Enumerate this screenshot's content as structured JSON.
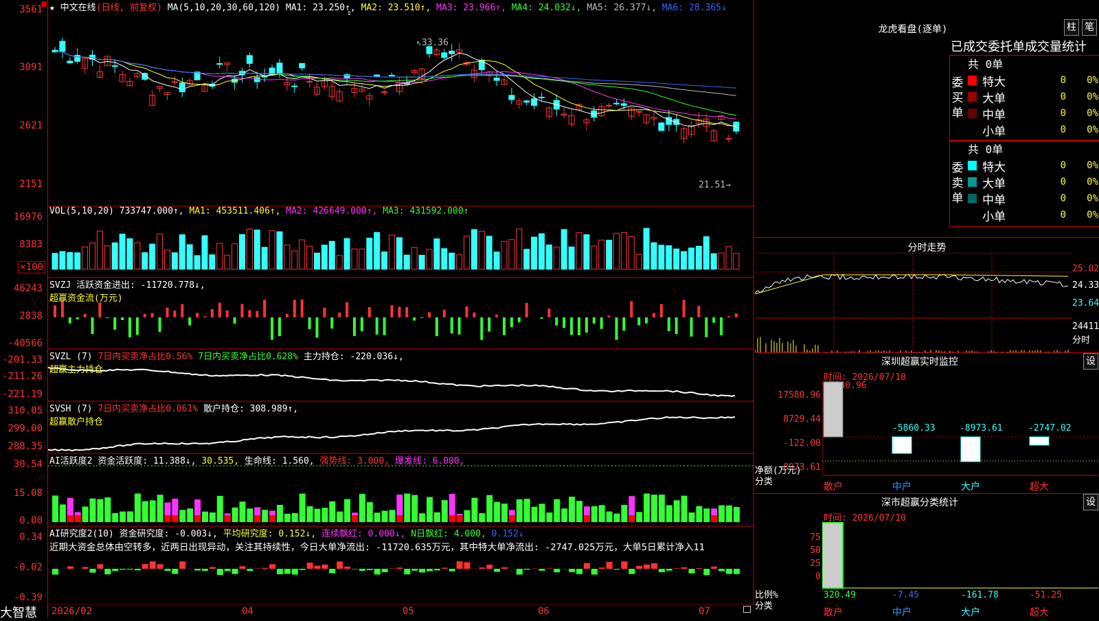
{
  "app": {
    "brand": "大智慧",
    "date_start": "2026/02",
    "month_labels": [
      "04",
      "05",
      "06",
      "07"
    ]
  },
  "kline": {
    "axis": [
      "3561",
      "3091",
      "2621",
      "2151"
    ],
    "title": "中文在线",
    "period": "(日线, 前复权)",
    "ma_label": "MA(5,10,20,30,60,120)",
    "ma1": "MA1: 23.250↑,",
    "ma2": "MA2: 23.510↑,",
    "ma3": "MA3: 23.966↑,",
    "ma4": "MA4: 24.032↓,",
    "ma5": "MA5: 26.377↓,",
    "ma6": "MA6: 28.365↓",
    "high_label": "33.36",
    "low_label": "21.51"
  },
  "vol": {
    "axis": [
      "16976",
      "8383"
    ],
    "unit": "×100",
    "label": "VOL(5,10,20)",
    "value": "733747.000↑,",
    "ma1": "MA1: 453511.406↑,",
    "ma2": "MA2: 426649.000↑,",
    "ma3": "MA3: 431592.000↑"
  },
  "svzj": {
    "axis": [
      "46243",
      "2838",
      "-40566"
    ],
    "label": "SVZJ  活跃资金进出: -11720.778↓,",
    "subtitle": "超赢资金流(万元)"
  },
  "svzl": {
    "axis": [
      "-201.33",
      "-211.26",
      "-221.19"
    ],
    "label": "SVZL (7)",
    "pct1": "7日内买卖净占比0.56%",
    "pct2": "7日内买卖净占比0.628%",
    "hold": "主力持仓: -220.036↓,",
    "subtitle": "超赢主力持仓"
  },
  "svsh": {
    "axis": [
      "310.05",
      "299.00",
      "288.35"
    ],
    "label": "SVSH (7)",
    "pct": "7日内买卖净占比0.061%",
    "hold": "散户持仓: 308.989↑,",
    "subtitle": "超赢散户持仓"
  },
  "ai_active": {
    "axis": [
      "30.54",
      "15.08",
      "0.00"
    ],
    "label": "AI活跃度2",
    "v1": "资金活跃度: 11.388↓,",
    "v2": "30.535,",
    "v3": "生命线: 1.560,",
    "v4": "强势线: 3.000,",
    "v5": "爆发线: 6.000,"
  },
  "ai_research": {
    "axis": [
      "0.34",
      "-0.02",
      "-0.39"
    ],
    "label": "AI研究度2(10)",
    "v1": "资金研究度: -0.003↓,",
    "v2": "平均研究度: 0.152↓,",
    "v3": "连续飘红: 0.000↓,",
    "v4": "N日飘红: 4.000,",
    "v5": "0.152↓",
    "comment": "近期大资金总体由空转多，近两日出现异动，关注其持续性，今日大单净流出: -11720.635万元，其中特大单净流出: -2747.025万元，大单5日累计净入11"
  },
  "lhb": {
    "title": "龙虎看盘(逐单)",
    "btn1": "柱",
    "btn2": "笔",
    "subtitle": "已成交委托单成交量统计",
    "buy_label": "委买单",
    "sell_label": "委卖单",
    "buy_total": "共 0单",
    "sell_total": "共 0单",
    "buy_rows": [
      {
        "name": "特大",
        "n": "0",
        "p": "0%",
        "color": "#ff0000"
      },
      {
        "name": "大单",
        "n": "0",
        "p": "0%",
        "color": "#990000"
      },
      {
        "name": "中单",
        "n": "0",
        "p": "0%",
        "color": "#660000"
      },
      {
        "name": "小单",
        "n": "0",
        "p": "0%",
        "color": "#000000"
      }
    ],
    "sell_rows": [
      {
        "name": "特大",
        "n": "0",
        "p": "0%",
        "color": "#00ffff"
      },
      {
        "name": "大单",
        "n": "0",
        "p": "0%",
        "color": "#009999"
      },
      {
        "name": "中单",
        "n": "0",
        "p": "0%",
        "color": "#006666"
      },
      {
        "name": "小单",
        "n": "0",
        "p": "0%",
        "color": "#000000"
      }
    ]
  },
  "intraday": {
    "title": "分时走势",
    "p1": "25.02",
    "p2": "24.33",
    "p3": "23.64",
    "vol": "24411",
    "vol_unit": "分时"
  },
  "monitor": {
    "title": "深圳超赢实时监控",
    "btn": "设",
    "time": "时间: 2026/07/10",
    "top_value": "17580.96",
    "axis": [
      "17580.96",
      "8729.44",
      "-122.00",
      "-8973.61"
    ],
    "ylabel": "净额(万元)",
    "xlabel": "分类",
    "bar_labels": [
      "-5860.33",
      "-8973.61",
      "-2747.02"
    ],
    "categories": [
      "散户",
      "中户",
      "大户",
      "超大"
    ]
  },
  "classify": {
    "title": "深市超赢分类统计",
    "btn": "设",
    "time": "时间: 2026/07/10",
    "axis": [
      "75",
      "50",
      "25",
      "0"
    ],
    "ylabel": "比例%",
    "xlabel": "分类",
    "values": [
      "320.49",
      "-7.45",
      "-161.78",
      "-51.25"
    ],
    "categories": [
      "散户",
      "中户",
      "大户",
      "超大"
    ]
  }
}
